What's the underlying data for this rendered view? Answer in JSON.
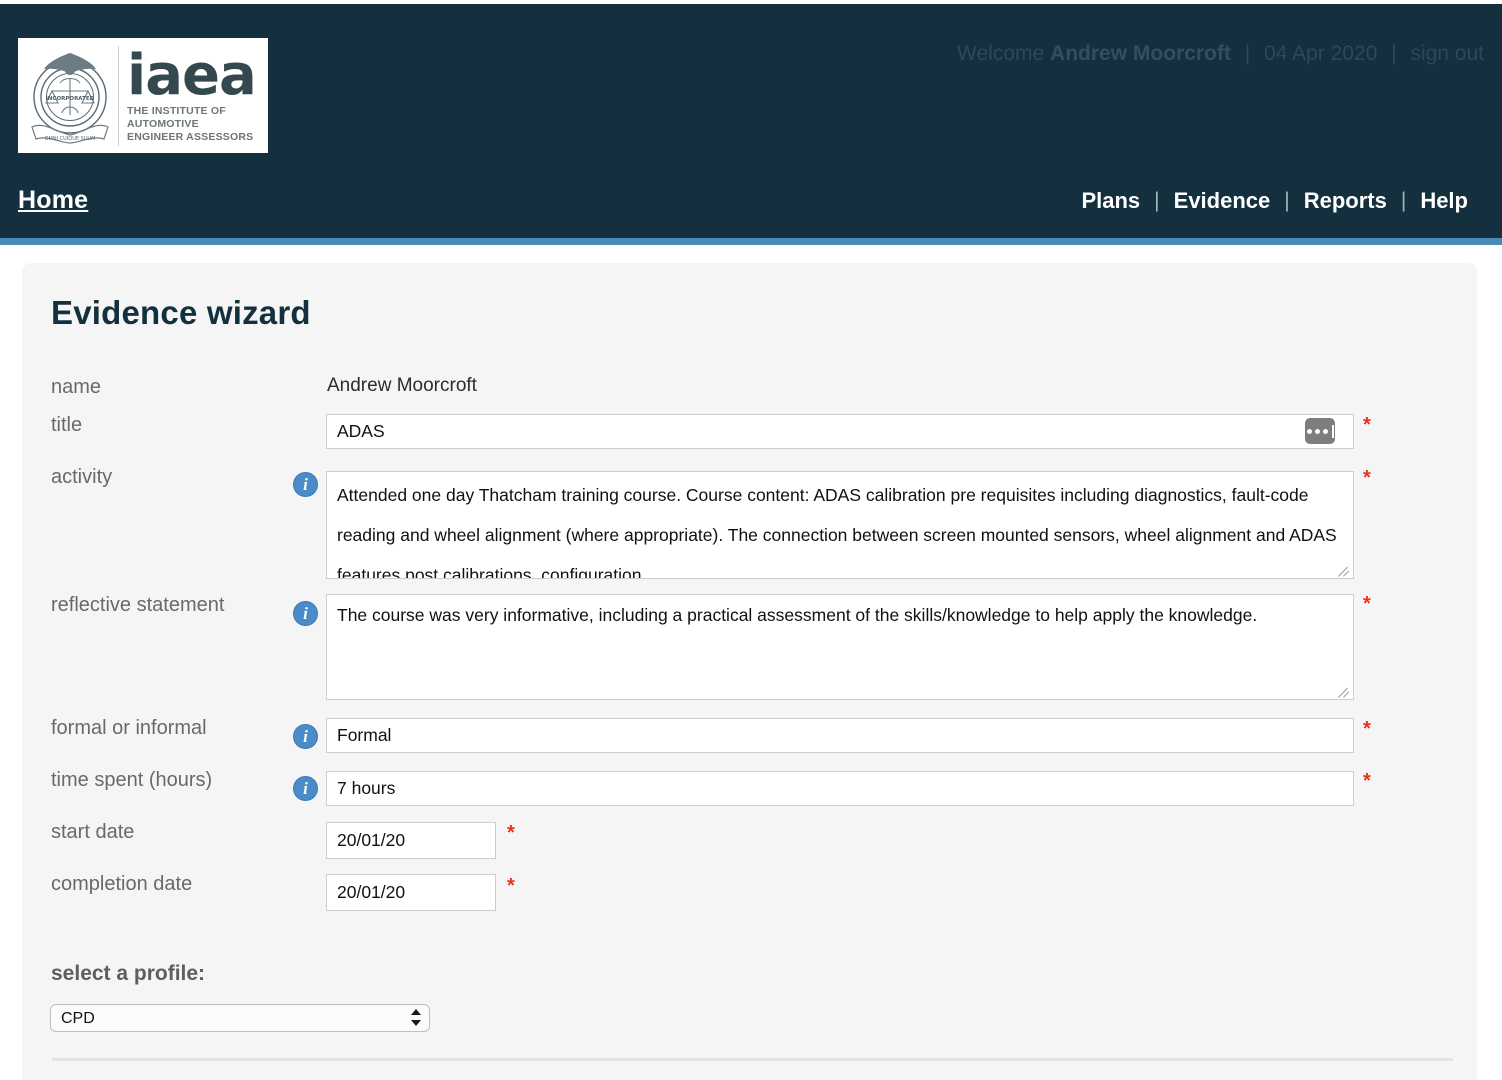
{
  "header": {
    "logo": {
      "wordmark": "iaea",
      "subtitle_line1": "THE INSTITUTE OF AUTOMOTIVE",
      "subtitle_line2": "ENGINEER ASSESSORS",
      "crest_text": "INCORPORATED"
    },
    "welcome_prefix": "Welcome",
    "user_name": "Andrew Moorcroft",
    "date": "04 Apr 2020",
    "sign_out": "sign out",
    "separator": "|"
  },
  "nav": {
    "home": "Home",
    "links": [
      {
        "label": "Plans"
      },
      {
        "label": "Evidence"
      },
      {
        "label": "Reports"
      },
      {
        "label": "Help"
      }
    ],
    "separator": "|"
  },
  "main": {
    "page_title": "Evidence wizard",
    "required_marker": "*",
    "info_glyph": "i",
    "fields": {
      "name": {
        "label": "name",
        "value": "Andrew Moorcroft"
      },
      "title": {
        "label": "title",
        "value": "ADAS",
        "placeholder": ""
      },
      "activity": {
        "label": "activity",
        "value": "Attended one day Thatcham training course. Course content: ADAS calibration pre requisites including diagnostics, fault-code reading and wheel alignment (where appropriate). The connection between screen mounted sensors, wheel alignment and ADAS features post calibrations, configuration",
        "placeholder": ""
      },
      "reflective_statement": {
        "label": "reflective statement",
        "value": "The course was very informative, including a practical assessment of the skills/knowledge to help apply the knowledge.",
        "placeholder": ""
      },
      "formal_or_informal": {
        "label": "formal or informal",
        "value": "Formal",
        "placeholder": ""
      },
      "time_spent": {
        "label": "time spent (hours)",
        "value": "7 hours",
        "placeholder": ""
      },
      "start_date": {
        "label": "start date",
        "value": "20/01/20",
        "placeholder": ""
      },
      "completion_date": {
        "label": "completion date",
        "value": "20/01/20",
        "placeholder": ""
      }
    },
    "profile": {
      "heading": "select a profile:",
      "selected": "CPD",
      "options": [
        "CPD"
      ]
    }
  },
  "colors": {
    "header_bg": "#14303f",
    "accent_bar": "#4a8ab5",
    "card_bg": "#f5f5f5",
    "title": "#13303f",
    "required": "#e8331c",
    "info_icon": "#4a8cc7"
  }
}
